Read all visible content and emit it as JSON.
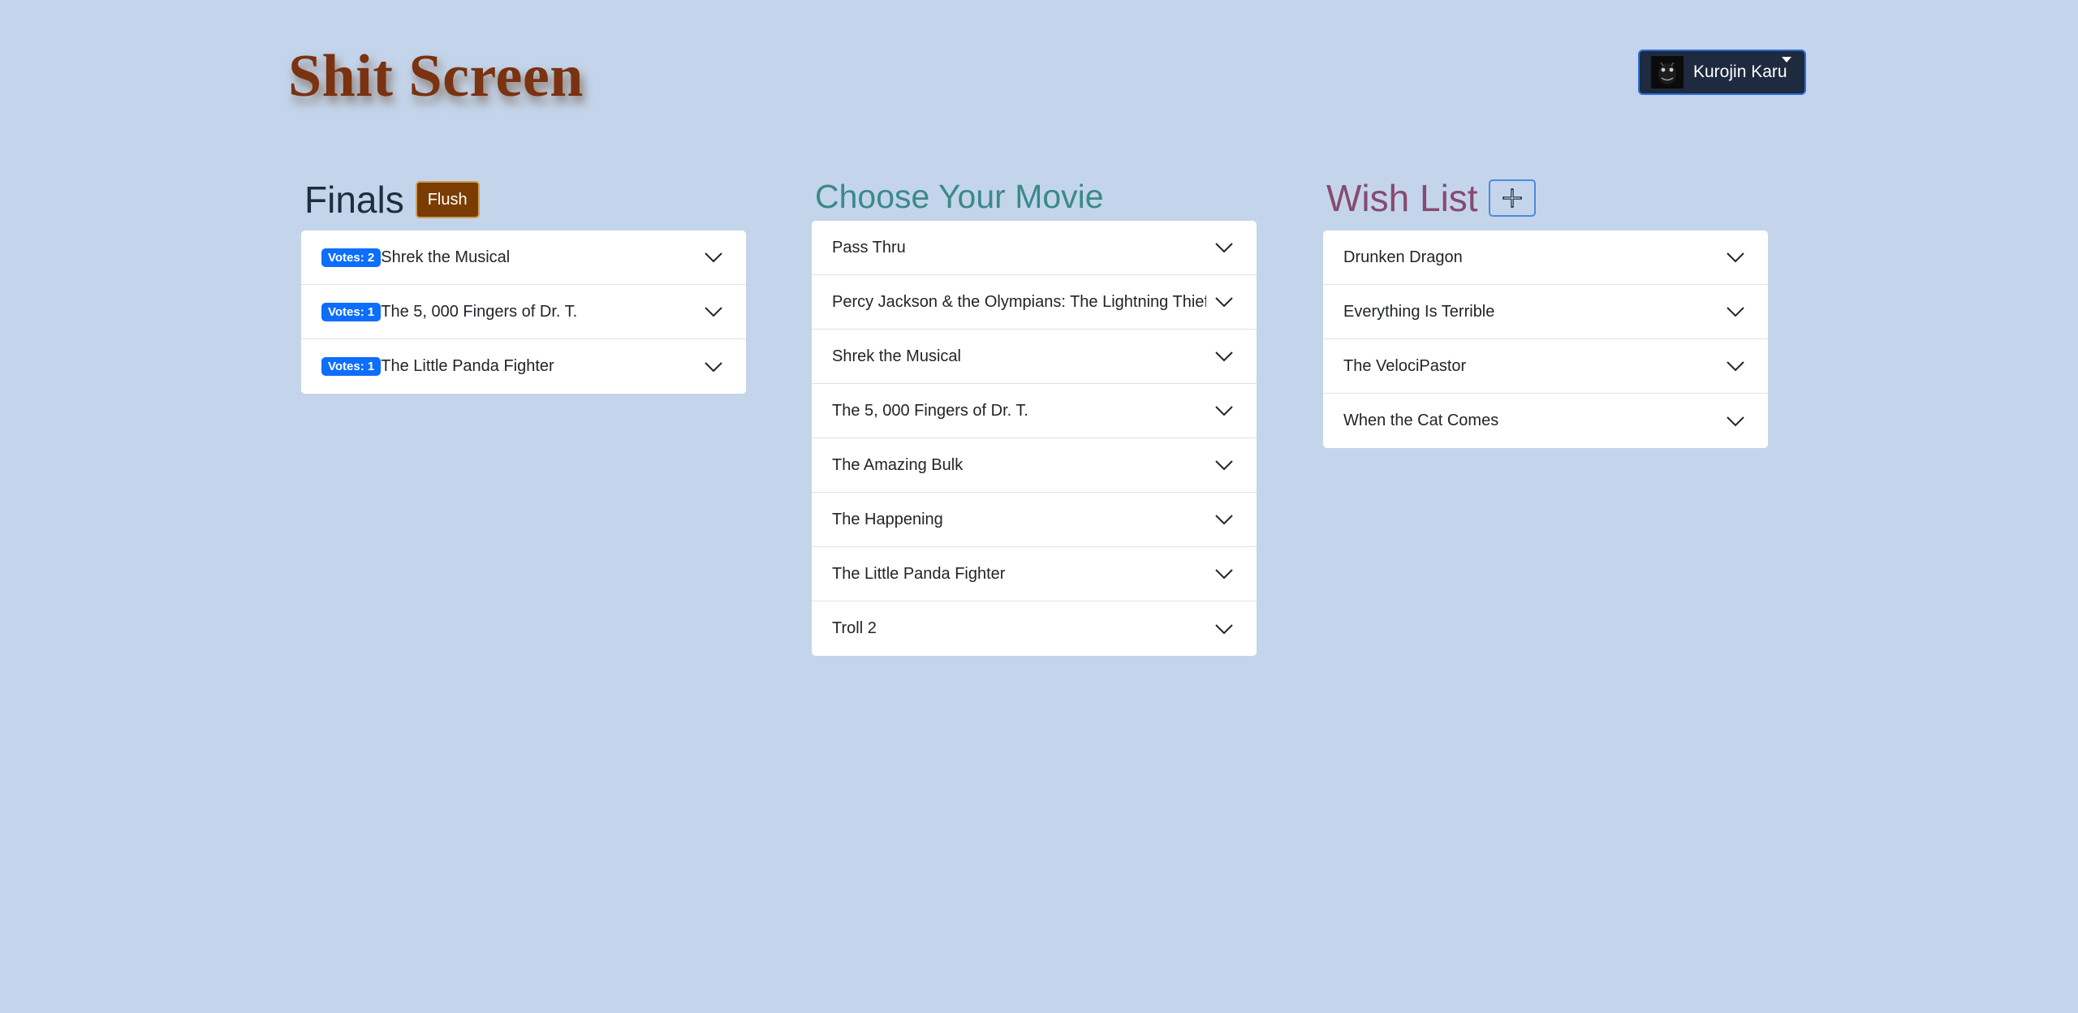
{
  "site": {
    "title": "Shit Screen"
  },
  "user": {
    "name": "Kurojin Karu"
  },
  "finals": {
    "heading": "Finals",
    "flush_label": "Flush",
    "items": [
      {
        "votes": "Votes: 2",
        "title": "Shrek the Musical"
      },
      {
        "votes": "Votes: 1",
        "title": "The 5, 000 Fingers of Dr. T."
      },
      {
        "votes": "Votes: 1",
        "title": "The Little Panda Fighter"
      }
    ]
  },
  "choose": {
    "heading": "Choose Your Movie",
    "items": [
      "Pass Thru",
      "Percy Jackson & the Olympians: The Lightning Thief",
      "Shrek the Musical",
      "The 5, 000 Fingers of Dr. T.",
      "The Amazing Bulk",
      "The Happening",
      "The Little Panda Fighter",
      "Troll 2"
    ]
  },
  "wish": {
    "heading": "Wish List",
    "add_icon": "plus-icon",
    "items": [
      "Drunken Dragon",
      "Everything Is Terrible",
      "The VelociPastor",
      "When the Cat Comes"
    ]
  },
  "colors": {
    "background": "#c4d5eb",
    "title": "#7a3210",
    "badge": "#0d6efd",
    "flush": "#7a3c00",
    "finals_heading": "#1f2d3d",
    "choose_heading": "#3a8a88",
    "wish_heading": "#874a70"
  }
}
